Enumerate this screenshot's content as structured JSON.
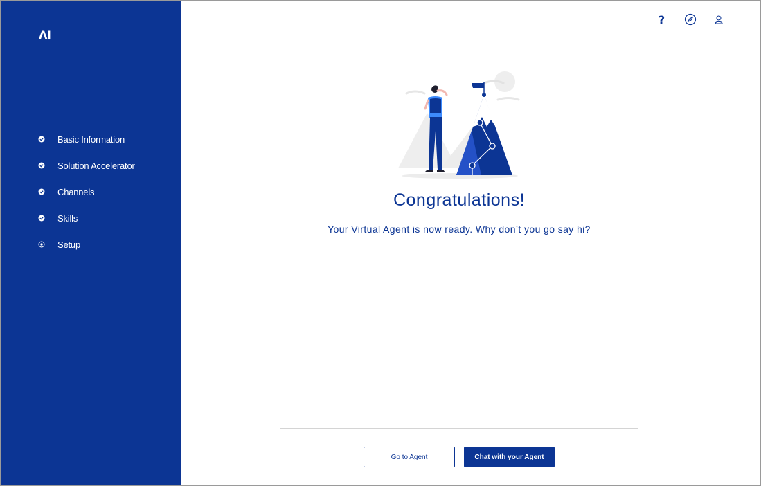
{
  "brand": {
    "logo_text": "ΛI"
  },
  "sidebar": {
    "steps": [
      {
        "label": "Basic Information",
        "status": "complete"
      },
      {
        "label": "Solution Accelerator",
        "status": "complete"
      },
      {
        "label": "Channels",
        "status": "complete"
      },
      {
        "label": "Skills",
        "status": "complete"
      },
      {
        "label": "Setup",
        "status": "current"
      }
    ]
  },
  "header": {
    "icons": [
      "help-icon",
      "compass-icon",
      "user-icon"
    ],
    "help_symbol": "?"
  },
  "main": {
    "title": "Congratulations!",
    "subtitle": "Your Virtual Agent is now ready. Why don’t you go say hi?"
  },
  "actions": {
    "secondary_label": "Go to Agent",
    "primary_label": "Chat with your Agent"
  },
  "colors": {
    "brand": "#0c3594",
    "accent": "#3d8bfd"
  }
}
